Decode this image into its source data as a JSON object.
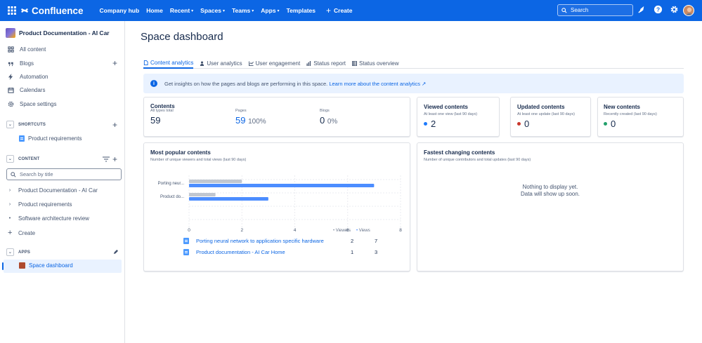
{
  "topnav": {
    "brand": "Confluence",
    "items": [
      {
        "label": "Company hub",
        "chevron": false
      },
      {
        "label": "Home",
        "chevron": false
      },
      {
        "label": "Recent",
        "chevron": true
      },
      {
        "label": "Spaces",
        "chevron": true
      },
      {
        "label": "Teams",
        "chevron": true
      },
      {
        "label": "Apps",
        "chevron": true
      },
      {
        "label": "Templates",
        "chevron": false
      }
    ],
    "create_label": "Create",
    "search_placeholder": "Search",
    "accent": "#0c66e4"
  },
  "sidebar": {
    "space_name": "Product Documentation - AI Car",
    "items": [
      {
        "label": "All content",
        "icon": "all-content-icon"
      },
      {
        "label": "Blogs",
        "icon": "quote-icon"
      },
      {
        "label": "Automation",
        "icon": "lightning-icon"
      },
      {
        "label": "Calendars",
        "icon": "calendar-icon"
      },
      {
        "label": "Space settings",
        "icon": "gear-icon"
      }
    ],
    "shortcuts_label": "SHORTCUTS",
    "shortcut_items": [
      "Product requirements"
    ],
    "content_label": "CONTENT",
    "filter_placeholder": "Search by title",
    "tree": [
      {
        "label": "Product Documentation - AI Car",
        "marker": "›"
      },
      {
        "label": "Product requirements",
        "marker": "›"
      },
      {
        "label": "Software architecture review",
        "marker": "•"
      },
      {
        "label": "Create",
        "marker": "+"
      }
    ],
    "apps_label": "APPS",
    "app_item": "Space dashboard"
  },
  "main": {
    "title": "Space dashboard",
    "tabs": [
      {
        "label": "Content analytics",
        "icon": "page-icon",
        "active": true
      },
      {
        "label": "User analytics",
        "icon": "person-icon",
        "active": false
      },
      {
        "label": "User engagement",
        "icon": "line-chart-icon",
        "active": false
      },
      {
        "label": "Status report",
        "icon": "bar-chart-icon",
        "active": false
      },
      {
        "label": "Status overview",
        "icon": "table-icon",
        "active": false
      }
    ],
    "banner_text": "Get insights on how the pages and blogs are performing in this space.",
    "banner_link": "Learn more about the content analytics ↗",
    "contents_card": {
      "title": "Contents",
      "metrics": [
        {
          "label": "All types total",
          "value": "59",
          "pct": ""
        },
        {
          "label": "Pages",
          "value": "59",
          "pct": "100%"
        },
        {
          "label": "Blogs",
          "value": "0",
          "pct": "0%"
        }
      ]
    },
    "small_cards": [
      {
        "title": "Viewed contents",
        "sub": "At least one view (last 90 days)",
        "value": "2",
        "color": "#1d7afc"
      },
      {
        "title": "Updated contents",
        "sub": "At least one update (last 90 days)",
        "value": "0",
        "color": "#c9372c"
      },
      {
        "title": "New contents",
        "sub": "Recently created (last 90 days)",
        "value": "0",
        "color": "#22a06b"
      }
    ],
    "popular": {
      "title": "Most popular contents",
      "sub": "Number of unique viewers and total views (last 90 days)",
      "legend_viewers": "Viewers",
      "legend_views": "Views",
      "rows": [
        {
          "title": "Porting neural network to application specific hardware",
          "viewers": "2",
          "views": "7"
        },
        {
          "title": "Product documentation - AI Car Home",
          "viewers": "1",
          "views": "3"
        }
      ]
    },
    "fastest": {
      "title": "Fastest changing contents",
      "sub": "Number of unique contributors and total updates (last 90 days)",
      "empty_line1": "Nothing to display yet.",
      "empty_line2": "Data will show up soon."
    }
  },
  "chart_data": {
    "type": "bar",
    "orientation": "horizontal",
    "categories": [
      "Porting neur...",
      "Product do..."
    ],
    "series": [
      {
        "name": "Viewers",
        "values": [
          2,
          1
        ],
        "color": "#c1c7d0"
      },
      {
        "name": "Views",
        "values": [
          7,
          3
        ],
        "color": "#4c8dff"
      }
    ],
    "xlim": [
      0,
      8
    ],
    "xticks": [
      "0",
      "2",
      "4",
      "6",
      "8"
    ],
    "grid": true,
    "legend": "bottom-right"
  }
}
